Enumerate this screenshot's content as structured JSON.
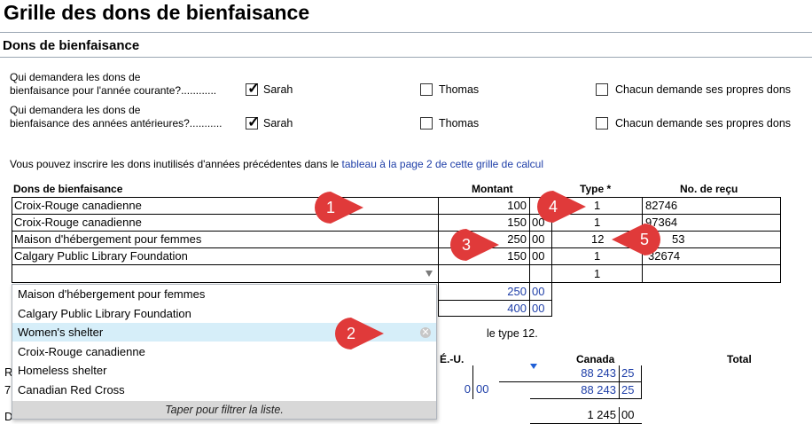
{
  "page": {
    "title": "Grille des dons de bienfaisance",
    "section": "Dons de bienfaisance",
    "intro": "Vous pouvez inscrire les dons inutilisés d'années précédentes dans le ",
    "intro_link": "tableau à la page 2 de cette grille de calcul"
  },
  "questions": [
    {
      "line1": "Qui demandera les dons de",
      "line2": "bienfaisance pour l'année courante?............",
      "opt1": "Sarah",
      "opt2": "Thomas",
      "opt3": "Chacun demande ses propres dons",
      "checked": "opt1"
    },
    {
      "line1": "Qui demandera les dons de",
      "line2": "bienfaisance des années antérieures?...........",
      "opt1": "Sarah",
      "opt2": "Thomas",
      "opt3": "Chacun demande ses propres dons",
      "checked": "opt1"
    }
  ],
  "table": {
    "headers": {
      "name": "Dons de bienfaisance",
      "amount": "Montant",
      "type": "Type *",
      "receipt": "No. de reçu"
    },
    "rows": [
      {
        "name": "Croix-Rouge canadienne",
        "amount": "100",
        "cents": "",
        "type": "1",
        "receipt": "82746"
      },
      {
        "name": "Croix-Rouge canadienne",
        "amount": "150",
        "cents": "00",
        "type": "1",
        "receipt": "97364"
      },
      {
        "name": "Maison d'hébergement pour femmes",
        "amount": "250",
        "cents": "00",
        "type": "12",
        "receipt": "53"
      },
      {
        "name": "Calgary Public Library Foundation",
        "amount": "150",
        "cents": "00",
        "type": "1",
        "receipt": "32674"
      },
      {
        "name": "",
        "amount": "",
        "cents": "",
        "type": "1",
        "receipt": ""
      }
    ],
    "subtotals": [
      {
        "amount": "250",
        "cents": "00"
      },
      {
        "amount": "400",
        "cents": "00"
      }
    ]
  },
  "dropdown": {
    "items": [
      "Maison d'hébergement pour femmes",
      "Calgary Public Library Foundation",
      "Women's shelter",
      "Croix-Rouge canadienne",
      "Homeless shelter",
      "Canadian Red Cross"
    ],
    "selected_index": 2,
    "hint": "Taper pour filtrer la liste."
  },
  "lower": {
    "type_note": "le type 12.",
    "col_us": "É.-U.",
    "col_canada": "Canada",
    "col_total": "Total",
    "row1_canada": "88 243",
    "row1_canada_cents": "25",
    "row2_us": "0",
    "row2_us_cents": "00",
    "row2_canada": "88 243",
    "row2_canada_cents": "25",
    "row3_value": "1 245",
    "row3_cents": "00",
    "left_frag1": "R",
    "left_frag2": "7",
    "left_frag3": "D"
  },
  "callouts": [
    "1",
    "2",
    "3",
    "4",
    "5"
  ],
  "colors": {
    "callout": "#e03a3a",
    "link": "#1f3fa8",
    "selected": "#d6eef9"
  }
}
